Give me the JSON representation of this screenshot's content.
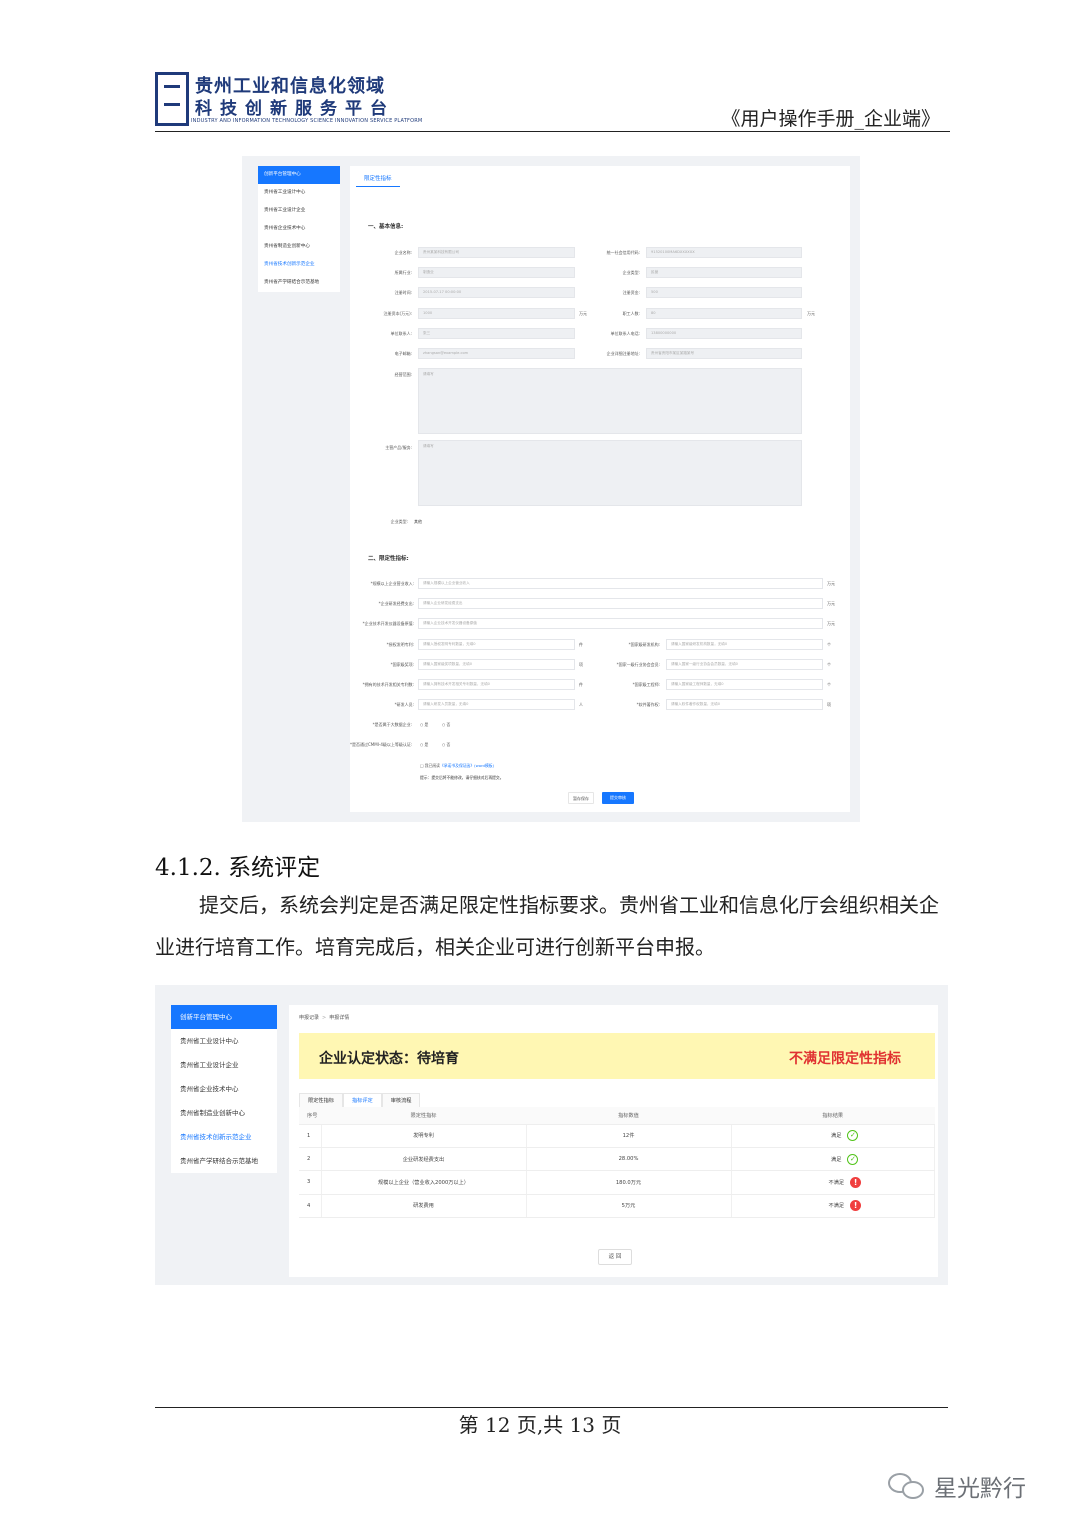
{
  "header": {
    "logo_line1": "贵州工业和信息化领域",
    "logo_line2": "科技创新服务平台",
    "logo_line3": "INDUSTRY AND INFORMATION TECHNOLOGY SCIENCE INNOVATION SERVICE PLATFORM",
    "doc_title": "《用户操作手册_企业端》"
  },
  "shot1": {
    "sidebar": [
      "创新平台管理中心",
      "贵州省工业设计中心",
      "贵州省工业设计企业",
      "贵州省企业技术中心",
      "贵州省制造业创新中心",
      "贵州省技术创新示范企业",
      "贵州省产学研结合示范基地"
    ],
    "tab": "限定性指标",
    "section1": "一、基本信息:",
    "fields_left": [
      {
        "label": "企业名称:",
        "value": "贵州某某科技有限公司"
      },
      {
        "label": "所属行业:",
        "value": "制造业"
      },
      {
        "label": "注册时间:",
        "value": "2015-07-17 00:00:00"
      },
      {
        "label": "注册资本(万元):",
        "value": "1000"
      },
      {
        "label": "单位联系人:",
        "value": "张三"
      },
      {
        "label": "电子邮箱:",
        "value": "zhangsan@example.com"
      }
    ],
    "fields_right": [
      {
        "label": "统一社会信用代码:",
        "value": "91520100MA6DXXXXXX"
      },
      {
        "label": "企业类型:",
        "value": "民营"
      },
      {
        "label": "注册资金:",
        "value": "500"
      },
      {
        "label": "职工人数:",
        "value": "80"
      },
      {
        "label": "单位联系人电话:",
        "value": "13800000000"
      },
      {
        "label": "企业详细注册地址:",
        "value": "贵州省贵阳市某区某路某号"
      }
    ],
    "unit_wanyuan": "万元",
    "textarea1_label": "经营范围:",
    "textarea1_value": "请填写",
    "textarea2_label": "主营产品/服务:",
    "textarea2_value": "请填写",
    "enterprise_type_label": "企业类型:",
    "enterprise_type_value": "其他",
    "section2": "二、限定性指标:",
    "indicators_full": [
      {
        "label": "*规模以上企业营业收入:",
        "placeholder": "请输入规模以上企业营业收入",
        "unit": "万元"
      },
      {
        "label": "*企业研发经费支出:",
        "placeholder": "请输入企业研发经费支出",
        "unit": "万元"
      },
      {
        "label": "*企业技术开发仪器设备原值:",
        "placeholder": "请输入企业技术开发仪器设备原值",
        "unit": "万元"
      }
    ],
    "indicators_left": [
      {
        "label": "*授权发明专利:",
        "placeholder": "请输入授权发明专利数量，无填0",
        "unit": "件"
      },
      {
        "label": "*国家级奖项:",
        "placeholder": "请输入国家级奖项数量，无填0",
        "unit": "项"
      },
      {
        "label": "*拥有的技术开发相关专利数:",
        "placeholder": "请输入拥有技术开发相关专利数量，无填0",
        "unit": "件"
      },
      {
        "label": "*研发人员:",
        "placeholder": "请输入研发人员数量，无填0",
        "unit": "人"
      }
    ],
    "indicators_right": [
      {
        "label": "*国家级研发机构:",
        "placeholder": "请输入国家级研发机构数量，无填0",
        "unit": "个"
      },
      {
        "label": "*国家一级行业协会会员:",
        "placeholder": "请输入国家一级行业协会会员数量，无填0",
        "unit": "个"
      },
      {
        "label": "*国家级工程师:",
        "placeholder": "请输入国家级工程师数量，无填0",
        "unit": "个"
      },
      {
        "label": "*软件著作权:",
        "placeholder": "请输入软件著作权数量，无填0",
        "unit": "项"
      }
    ],
    "radio1_label": "*是否属于大数据企业:",
    "radio2_label": "*是否通过CMMI-4级以上等级认证:",
    "radio_yes": "是",
    "radio_no": "否",
    "agree_prefix": "我已阅读",
    "agree_link": "《承诺书及保证函》",
    "agree_link2": "(word模板)",
    "warning": "提示：提交后将不能修改，请仔细核对后再提交。",
    "btn_save": "暂存保存",
    "btn_submit": "提交审核"
  },
  "section": {
    "heading": "4.1.2.  系统评定",
    "paragraph": "提交后，系统会判定是否满足限定性指标要求。贵州省工业和信息化厅会组织相关企业进行培育工作。培育完成后，相关企业可进行创新平台申报。"
  },
  "shot2": {
    "sidebar": [
      "创新平台管理中心",
      "贵州省工业设计中心",
      "贵州省工业设计企业",
      "贵州省企业技术中心",
      "贵州省制造业创新中心",
      "贵州省技术创新示范企业",
      "贵州省产学研结合示范基地"
    ],
    "breadcrumb": [
      "申报记录",
      "申报详情"
    ],
    "status_text": "企业认定状态：待培育",
    "status_result": "不满足限定性指标",
    "tabs": [
      "限定性指标",
      "指标评定",
      "审核流程"
    ],
    "columns": [
      "序号",
      "限定性指标",
      "指标数值",
      "指标结果"
    ],
    "rows": [
      {
        "no": "1",
        "name": "发明专利",
        "value": "12件",
        "result": "满足",
        "ok": true
      },
      {
        "no": "2",
        "name": "企业研发经费支出",
        "value": "28.00%",
        "result": "满足",
        "ok": true
      },
      {
        "no": "3",
        "name": "规模以上企业（营业收入2000万以上）",
        "value": "180.0万元",
        "result": "不满足",
        "ok": false
      },
      {
        "no": "4",
        "name": "研发费用",
        "value": "5万元",
        "result": "不满足",
        "ok": false
      }
    ],
    "back_button": "返 回"
  },
  "footer": {
    "page_text": "第 12 页,共 13 页",
    "watermark": "星光黔行"
  },
  "colors": {
    "primary": "#1677ff",
    "status_bg": "#fff7b3",
    "error": "#e03131",
    "success": "#52c41a",
    "logo": "#1f3a7a"
  }
}
